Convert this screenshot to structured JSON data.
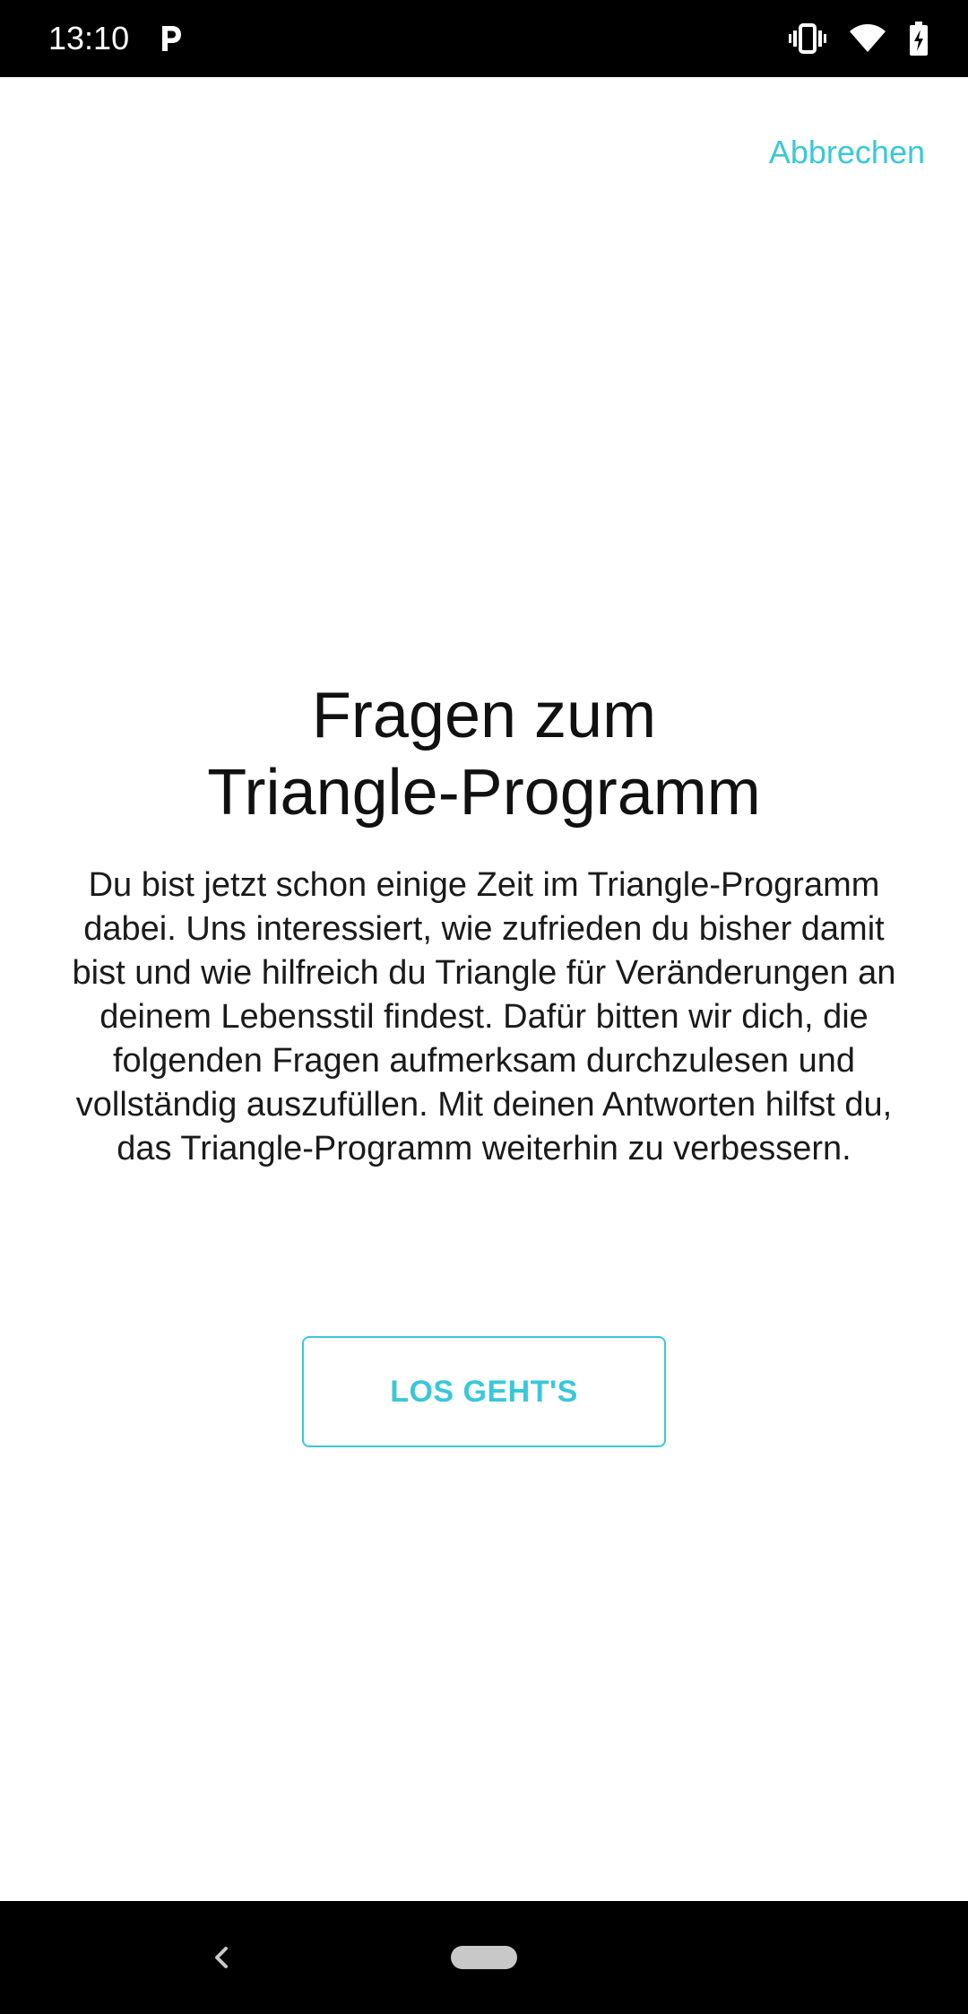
{
  "status_bar": {
    "time": "13:10",
    "notification_icon": "parking-icon",
    "icons": [
      "vibrate-icon",
      "wifi-icon",
      "battery-charging-icon"
    ]
  },
  "header": {
    "cancel_label": "Abbrechen"
  },
  "main": {
    "title_line1": "Fragen zum",
    "title_line2": "Triangle-Programm",
    "description": "Du bist jetzt schon einige Zeit im Triangle-Programm dabei. Uns interessiert, wie zufrieden du bisher damit bist und wie hilfreich du Triangle für Veränderungen an deinem Lebensstil findest. Dafür bitten wir dich, die folgenden Fragen aufmerksam durchzulesen und vollständig auszufüllen. Mit deinen Antworten hilfst du, das Triangle-Programm weiterhin zu verbessern.",
    "start_button_label": "LOS GEHT'S"
  },
  "nav_bar": {
    "icons": [
      "back-icon",
      "home-pill-icon"
    ]
  },
  "colors": {
    "accent": "#3ac7d9",
    "text": "#111111",
    "bars": "#000000"
  }
}
